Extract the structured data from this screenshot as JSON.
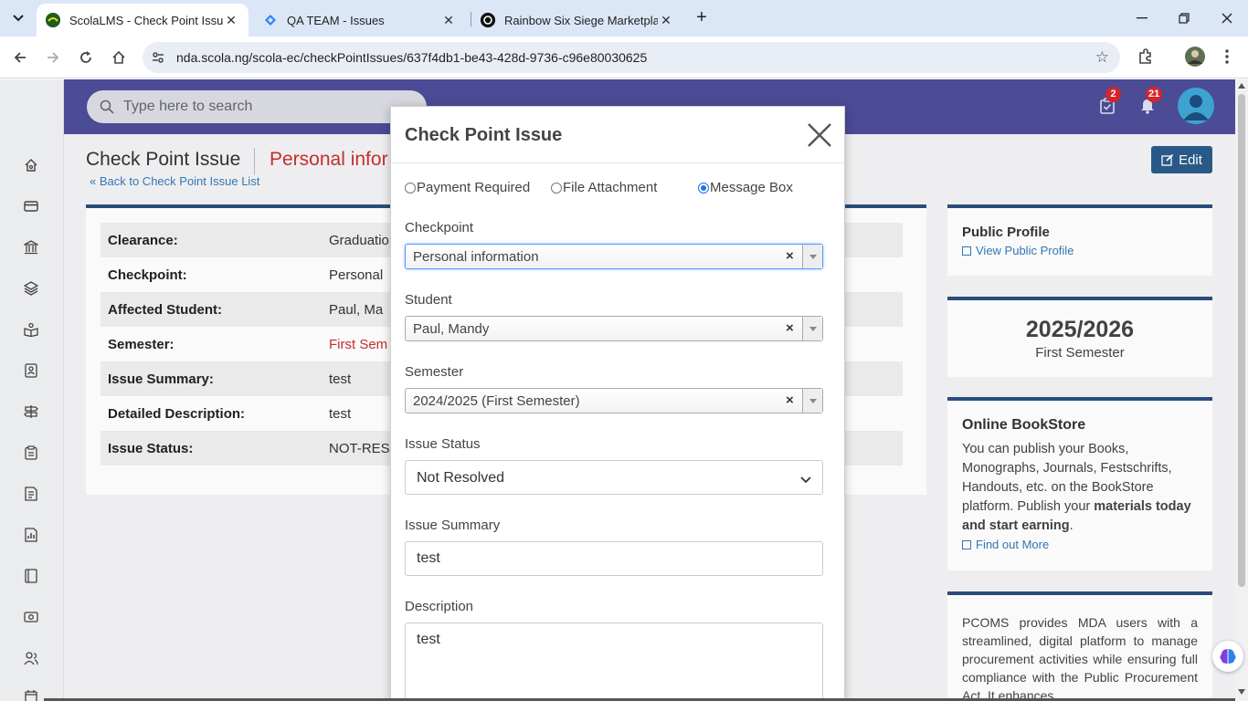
{
  "browser": {
    "tabs": [
      {
        "title": "ScolaLMS - Check Point Issue",
        "active": true
      },
      {
        "title": "QA TEAM - Issues",
        "active": false
      },
      {
        "title": "Rainbow Six Siege Marketplace",
        "active": false
      }
    ],
    "close_glyph": "✕",
    "new_tab_glyph": "+",
    "url": "nda.scola.ng/scola-ec/checkPointIssues/637f4db1-be43-428d-9736-c96e80030625"
  },
  "topbar": {
    "search_placeholder": "Type here to search",
    "tasks_badge": "2",
    "notifications_badge": "21"
  },
  "page": {
    "title": "Check Point Issue",
    "subtitle": "Personal infor",
    "back_link": "« Back to Check Point Issue List",
    "edit_label": "Edit",
    "details": [
      {
        "label": "Clearance:",
        "value": "Graduatio"
      },
      {
        "label": "Checkpoint:",
        "value": "Personal"
      },
      {
        "label": "Affected Student:",
        "value": "Paul, Ma"
      },
      {
        "label": "Semester:",
        "value": "First Sem"
      },
      {
        "label": "Issue Summary:",
        "value": "test"
      },
      {
        "label": "Detailed Description:",
        "value": "test"
      },
      {
        "label": "Issue Status:",
        "value": "NOT-RES"
      }
    ]
  },
  "right_panel": {
    "public_profile": {
      "title": "Public Profile",
      "link": "View Public Profile"
    },
    "session": {
      "year": "2025/2026",
      "semester": "First Semester"
    },
    "bookstore": {
      "title": "Online BookStore",
      "text_before": "You can publish your Books, Monographs, Journals, Festschrifts, Handouts, etc. on the BookStore platform. Publish your ",
      "text_bold": "materials today and start earning",
      "text_after": ".",
      "link": "Find out More"
    },
    "pcoms": {
      "text": "PCOMS provides MDA users with a streamlined, digital platform to manage procurement activities while ensuring full compliance with the Public Procurement Act. It enhances"
    }
  },
  "modal": {
    "title": "Check Point Issue",
    "radio_options": [
      {
        "label": "Payment Required",
        "checked": false
      },
      {
        "label": "File Attachment",
        "checked": false
      },
      {
        "label": "Message Box",
        "checked": true
      }
    ],
    "checkpoint": {
      "label": "Checkpoint",
      "value": "Personal information"
    },
    "student": {
      "label": "Student",
      "value": "Paul, Mandy"
    },
    "semester": {
      "label": "Semester",
      "value": "2024/2025 (First Semester)"
    },
    "issue_status": {
      "label": "Issue Status",
      "value": "Not Resolved"
    },
    "issue_summary": {
      "label": "Issue Summary",
      "value": "test"
    },
    "description": {
      "label": "Description",
      "value": "test"
    },
    "clear_glyph": "×"
  },
  "colors": {
    "topbar": "#4d4d99",
    "accent_red": "#c9302c",
    "link_blue": "#337ab7",
    "edit_button": "#2a5c8a"
  }
}
